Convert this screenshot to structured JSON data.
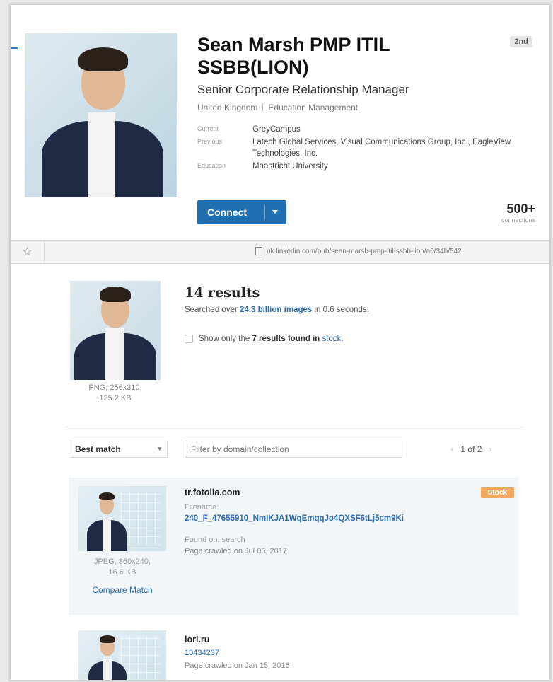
{
  "profile": {
    "name": "Sean Marsh PMP ITIL SSBB(LION)",
    "degree_badge": "2nd",
    "headline": "Senior Corporate Relationship Manager",
    "location": "United Kingdom",
    "industry": "Education Management",
    "facts": [
      {
        "key": "Current",
        "value": "GreyCampus"
      },
      {
        "key": "Previous",
        "value": "Latech Global Services, Visual Communications Group, Inc., EagleView Technologies, Inc."
      },
      {
        "key": "Education",
        "value": "Maastricht University"
      }
    ],
    "connect_label": "Connect",
    "connections_count": "500+",
    "connections_label": "connections"
  },
  "urlbar": {
    "url": "uk.linkedin.com/pub/sean-marsh-pmp-itil-ssbb-lion/a0/34b/542"
  },
  "search": {
    "query_image_meta_line1": "PNG, 256x310,",
    "query_image_meta_line2": "125.2 KB",
    "results_title": "14 results",
    "searched_prefix": "Searched over",
    "searched_count": "24.3 billion images",
    "searched_suffix": "in 0.6 seconds.",
    "stock_prefix": "Show only the",
    "stock_count": "7 results found in",
    "stock_link": "stock",
    "sort_value": "Best match",
    "filter_placeholder": "Filter by domain/collection",
    "pager": "1 of 2"
  },
  "results": [
    {
      "domain": "tr.fotolia.com",
      "filename_label": "Filename:",
      "filename": "240_F_47655910_NmIKJA1WqEmqqJo4QXSF6tLj5cm9Ki",
      "found_on": "Found on: search",
      "crawled": "Page crawled on Jul 06, 2017",
      "meta_line1": "JPEG, 360x240,",
      "meta_line2": "16.6 KB",
      "compare": "Compare Match",
      "badge": "Stock"
    },
    {
      "domain": "lori.ru",
      "filename": "10434237",
      "crawled": "Page crawled on Jan 15, 2016"
    }
  ],
  "colors": {
    "linkedin_blue": "#1f6fb1",
    "link_blue": "#2b6ab0",
    "stock_badge": "#f0a862"
  }
}
